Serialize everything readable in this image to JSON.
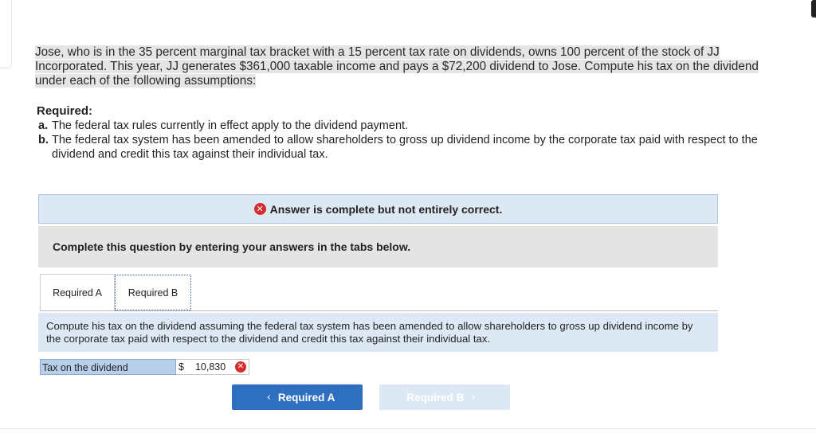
{
  "question": {
    "line1": "Jose, who is in the 35 percent marginal tax bracket with a 15 percent tax rate on dividends, owns 100 percent of the stock of JJ",
    "line2": "Incorporated. This year, JJ generates $361,000 taxable income and pays a $72,200 dividend to Jose. Compute his tax on the dividend",
    "line3": "under each of the following assumptions:"
  },
  "required": {
    "title": "Required:",
    "items": [
      {
        "letter": "a.",
        "text": "The federal tax rules currently in effect apply to the dividend payment."
      },
      {
        "letter": "b.",
        "text": "The federal tax system has been amended to allow shareholders to gross up dividend income by the corporate tax paid with respect to the dividend and credit this tax against their individual tax."
      }
    ]
  },
  "status": {
    "icon": "x-circle-icon",
    "text": "Answer is complete but not entirely correct."
  },
  "instructions": "Complete this question by entering your answers in the tabs below.",
  "tabs": [
    {
      "label": "Required A"
    },
    {
      "label": "Required B"
    }
  ],
  "content": {
    "text": "Compute his tax on the dividend assuming the federal tax system has been amended to allow shareholders to gross up dividend income by the corporate tax paid with respect to the dividend and credit this tax against their individual tax."
  },
  "answer": {
    "label": "Tax on the dividend",
    "currency": "$",
    "value": "10,830",
    "status_icon": "x-circle-icon"
  },
  "nav": {
    "prev_label": "Required A",
    "next_label": "Required B"
  },
  "colors": {
    "accent": "#2f6fbf",
    "error": "#d62c2c",
    "info_bg": "#dde8f5"
  }
}
